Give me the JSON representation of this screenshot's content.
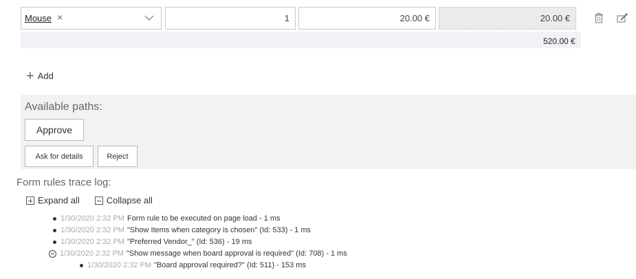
{
  "line_item": {
    "product": "Mouse",
    "remove_glyph": "×",
    "quantity": "1",
    "unit_price": "20.00 €",
    "line_total": "20.00 €",
    "icons": [
      "delete-icon",
      "edit-icon"
    ]
  },
  "grand_total": "520.00 €",
  "add_label": "Add",
  "paths": {
    "label": "Available paths:",
    "buttons": {
      "approve": "Approve",
      "ask": "Ask for details",
      "reject": "Reject"
    }
  },
  "trace": {
    "title": "Form rules trace log:",
    "expand_all": "Expand all",
    "collapse_all": "Collapse all",
    "entries": [
      {
        "time": "1/30/2020 2:32 PM",
        "text": "Form rule to be executed on page load - 1 ms"
      },
      {
        "time": "1/30/2020 2:32 PM",
        "text": "\"Show Items when category is chosen\" (Id: 533) - 1 ms"
      },
      {
        "time": "1/30/2020 2:32 PM",
        "text": "\"Preferred Vendor_\" (Id: 536) - 19 ms"
      },
      {
        "time": "1/30/2020 2:32 PM",
        "text": "\"Show message when board approval is required\" (Id: 708) - 1 ms"
      },
      {
        "time": "1/30/2020 2:32 PM",
        "text": "\"Board approval required?\" (Id: 511) - 153 ms"
      }
    ]
  }
}
